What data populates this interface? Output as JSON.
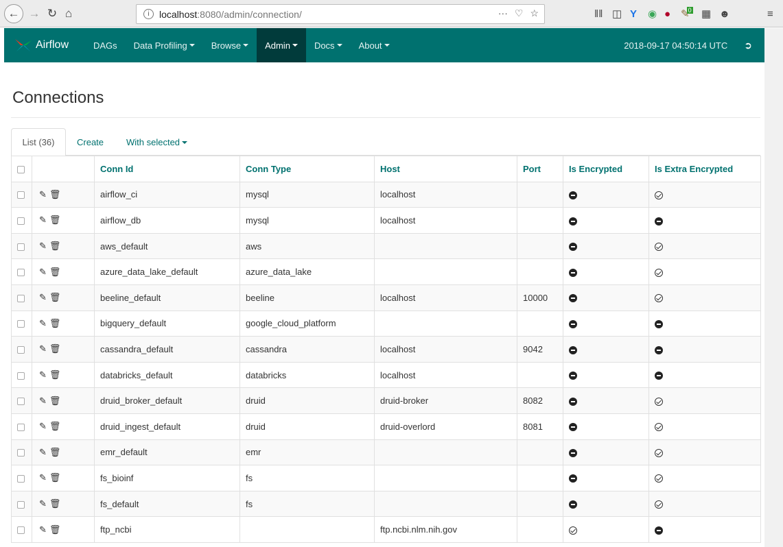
{
  "browser": {
    "url_host": "localhost",
    "url_path": ":8080/admin/connection/",
    "url_actions": [
      "···",
      "♡",
      "☆"
    ],
    "badge": "0"
  },
  "navbar": {
    "brand": "Airflow",
    "items": [
      {
        "label": "DAGs",
        "dropdown": false
      },
      {
        "label": "Data Profiling",
        "dropdown": true
      },
      {
        "label": "Browse",
        "dropdown": true
      },
      {
        "label": "Admin",
        "dropdown": true,
        "active": true
      },
      {
        "label": "Docs",
        "dropdown": true
      },
      {
        "label": "About",
        "dropdown": true
      }
    ],
    "timestamp": "2018-09-17 04:50:14 UTC"
  },
  "page": {
    "title": "Connections",
    "tabs": {
      "list": "List (36)",
      "create": "Create",
      "with_selected": "With selected"
    }
  },
  "table": {
    "columns": [
      "Conn Id",
      "Conn Type",
      "Host",
      "Port",
      "Is Encrypted",
      "Is Extra Encrypted"
    ],
    "rows": [
      {
        "conn_id": "airflow_ci",
        "conn_type": "mysql",
        "host": "localhost",
        "port": "",
        "is_encrypted": false,
        "is_extra_encrypted": true
      },
      {
        "conn_id": "airflow_db",
        "conn_type": "mysql",
        "host": "localhost",
        "port": "",
        "is_encrypted": false,
        "is_extra_encrypted": false
      },
      {
        "conn_id": "aws_default",
        "conn_type": "aws",
        "host": "",
        "port": "",
        "is_encrypted": false,
        "is_extra_encrypted": true
      },
      {
        "conn_id": "azure_data_lake_default",
        "conn_type": "azure_data_lake",
        "host": "",
        "port": "",
        "is_encrypted": false,
        "is_extra_encrypted": true
      },
      {
        "conn_id": "beeline_default",
        "conn_type": "beeline",
        "host": "localhost",
        "port": "10000",
        "is_encrypted": false,
        "is_extra_encrypted": true
      },
      {
        "conn_id": "bigquery_default",
        "conn_type": "google_cloud_platform",
        "host": "",
        "port": "",
        "is_encrypted": false,
        "is_extra_encrypted": false
      },
      {
        "conn_id": "cassandra_default",
        "conn_type": "cassandra",
        "host": "localhost",
        "port": "9042",
        "is_encrypted": false,
        "is_extra_encrypted": false
      },
      {
        "conn_id": "databricks_default",
        "conn_type": "databricks",
        "host": "localhost",
        "port": "",
        "is_encrypted": false,
        "is_extra_encrypted": false
      },
      {
        "conn_id": "druid_broker_default",
        "conn_type": "druid",
        "host": "druid-broker",
        "port": "8082",
        "is_encrypted": false,
        "is_extra_encrypted": true
      },
      {
        "conn_id": "druid_ingest_default",
        "conn_type": "druid",
        "host": "druid-overlord",
        "port": "8081",
        "is_encrypted": false,
        "is_extra_encrypted": true
      },
      {
        "conn_id": "emr_default",
        "conn_type": "emr",
        "host": "",
        "port": "",
        "is_encrypted": false,
        "is_extra_encrypted": true
      },
      {
        "conn_id": "fs_bioinf",
        "conn_type": "fs",
        "host": "",
        "port": "",
        "is_encrypted": false,
        "is_extra_encrypted": true
      },
      {
        "conn_id": "fs_default",
        "conn_type": "fs",
        "host": "",
        "port": "",
        "is_encrypted": false,
        "is_extra_encrypted": true
      },
      {
        "conn_id": "ftp_ncbi",
        "conn_type": "",
        "host": "ftp.ncbi.nlm.nih.gov",
        "port": "",
        "is_encrypted": true,
        "is_extra_encrypted": false
      }
    ]
  },
  "icons": {
    "edit": "pencil-icon",
    "delete": "trash-icon",
    "encrypted_true": "check-circle-icon",
    "encrypted_false": "minus-circle-icon"
  },
  "colors": {
    "navbar": "#00716f",
    "navbar_active": "#013b3b",
    "link": "#00716f"
  }
}
